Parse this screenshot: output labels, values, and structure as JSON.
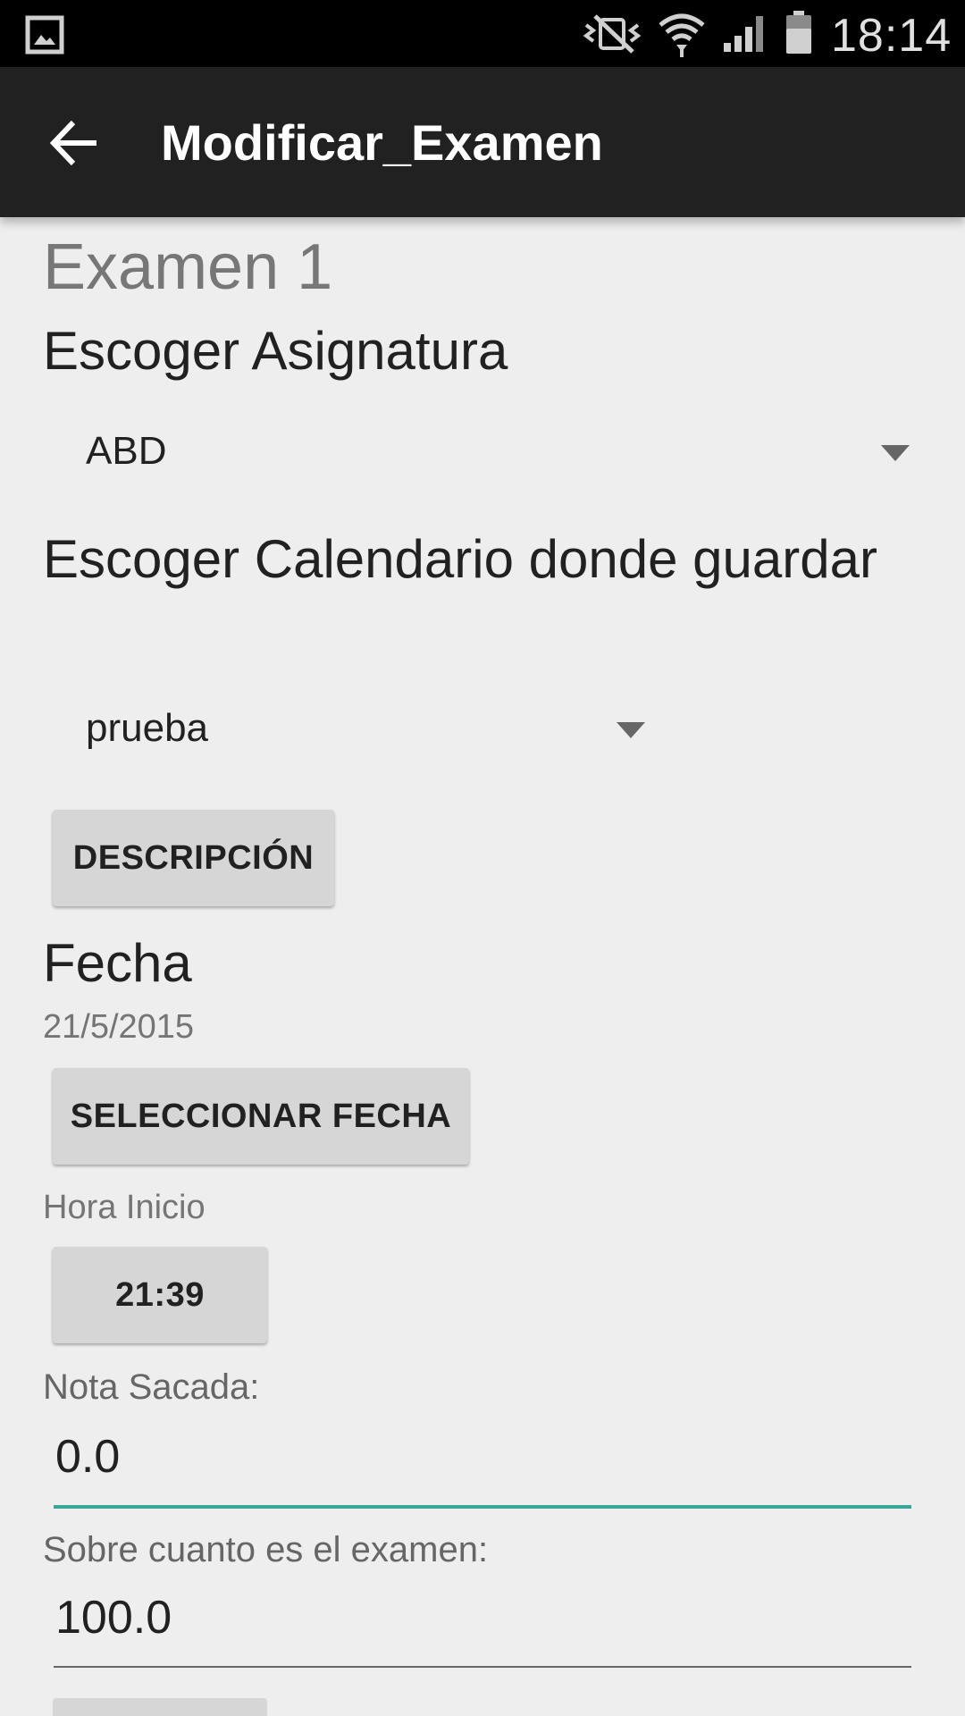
{
  "status_bar": {
    "time": "18:14",
    "icons": [
      "gallery-icon",
      "mute-icon",
      "wifi-icon",
      "signal-icon",
      "battery-icon"
    ]
  },
  "app_bar": {
    "back_icon": "arrow-left-icon",
    "title": "Modificar_Examen"
  },
  "form": {
    "exam_title": "Examen 1",
    "subject_label": "Escoger Asignatura",
    "subject_value": "ABD",
    "calendar_label": "Escoger Calendario donde guardar",
    "calendar_value": "prueba",
    "description_button": "DESCRIPCIÓN",
    "date_label": "Fecha",
    "date_value": "21/5/2015",
    "select_date_button": "SELECCIONAR FECHA",
    "start_time_label": "Hora Inicio",
    "start_time_button": "21:39",
    "grade_label": "Nota Sacada:",
    "grade_value": "0.0",
    "total_label": "Sobre cuanto es el examen:",
    "total_value": "100.0"
  },
  "colors": {
    "app_bar": "#212121",
    "status_bar": "#000000",
    "background": "#eeeeee",
    "accent_underline": "#3aa69a"
  }
}
